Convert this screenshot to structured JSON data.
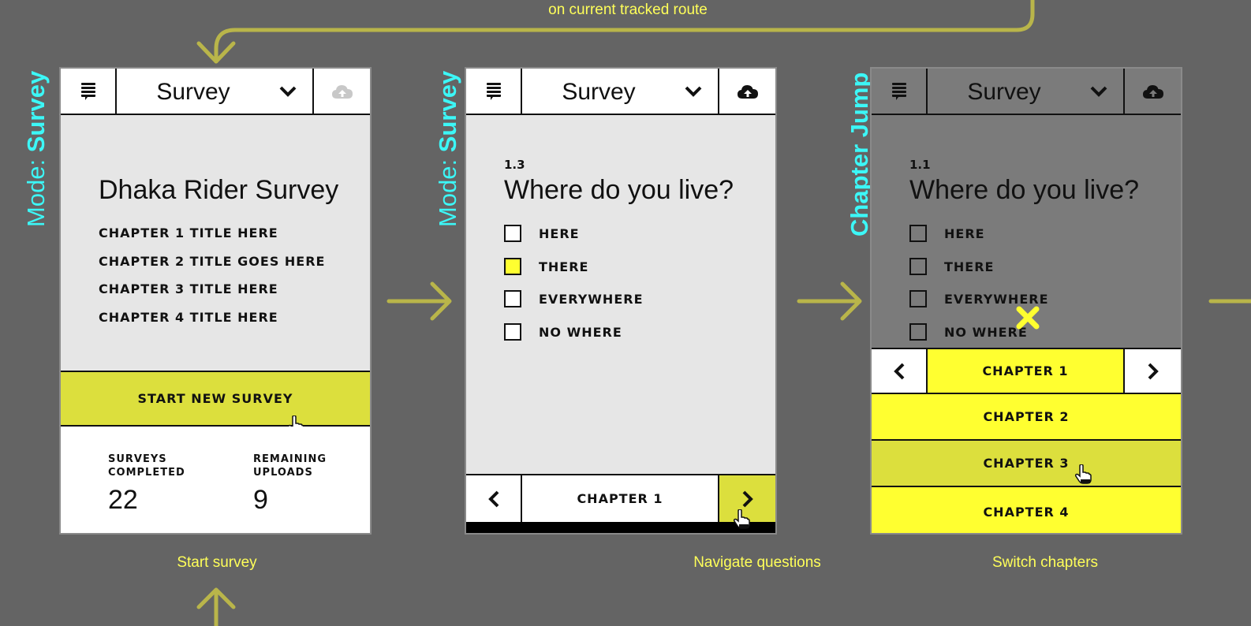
{
  "annotations": {
    "top_note": "on current tracked route",
    "captions": [
      "Start survey",
      "Navigate questions",
      "Switch chapters"
    ]
  },
  "mode_labels": [
    {
      "prefix": "Mode:",
      "name": "Survey"
    },
    {
      "prefix": "Mode:",
      "name": "Survey"
    },
    {
      "prefix": "",
      "name": "Chapter Jump"
    }
  ],
  "colors": {
    "background": "#646464",
    "accent_yellow": "#ffff30",
    "accent_olive": "#dcdf3d",
    "mode_cyan": "#3cf7f7",
    "caption_yellow": "#ffff59",
    "flow_arrow": "#b9b54a"
  },
  "screens": [
    {
      "header": {
        "title": "Survey",
        "menu_icon": "menu-icon",
        "dropdown_icon": "chevron-down-icon",
        "upload_icon": "cloud-upload-icon",
        "upload_enabled": false
      },
      "survey_title": "Dhaka Rider Survey",
      "chapters": [
        "CHAPTER 1 TITLE HERE",
        "CHAPTER 2 TITLE GOES HERE",
        "CHAPTER 3 TITLE HERE",
        "CHAPTER 4 TITLE HERE"
      ],
      "start_button": "START NEW SURVEY",
      "stats": [
        {
          "label": "SURVEYS\nCOMPLETED",
          "value": "22"
        },
        {
          "label": "REMAINING\nUPLOADS",
          "value": "9"
        }
      ]
    },
    {
      "header": {
        "title": "Survey",
        "menu_icon": "menu-icon",
        "dropdown_icon": "chevron-down-icon",
        "upload_icon": "cloud-upload-icon",
        "upload_enabled": true
      },
      "question_number": "1.3",
      "question": "Where do you live?",
      "options": [
        {
          "label": "HERE",
          "checked": false
        },
        {
          "label": "THERE",
          "checked": true
        },
        {
          "label": "EVERYWHERE",
          "checked": false
        },
        {
          "label": "NO WHERE",
          "checked": false
        }
      ],
      "nav": {
        "prev_icon": "chevron-left-icon",
        "chapter": "CHAPTER 1",
        "next_icon": "chevron-right-icon"
      }
    },
    {
      "header": {
        "title": "Survey",
        "menu_icon": "menu-icon",
        "dropdown_icon": "chevron-down-icon",
        "upload_icon": "cloud-upload-icon",
        "upload_enabled": true
      },
      "question_number": "1.1",
      "question": "Where do you live?",
      "options": [
        {
          "label": "HERE",
          "checked": false
        },
        {
          "label": "THERE",
          "checked": false
        },
        {
          "label": "EVERYWHERE",
          "checked": false
        },
        {
          "label": "NO WHERE",
          "checked": false
        }
      ],
      "chapter_jump": {
        "current": "CHAPTER 1",
        "prev_icon": "chevron-left-icon",
        "next_icon": "chevron-right-icon",
        "close_icon": "close-x-icon",
        "options": [
          "CHAPTER 2",
          "CHAPTER 3",
          "CHAPTER 4"
        ]
      }
    }
  ]
}
